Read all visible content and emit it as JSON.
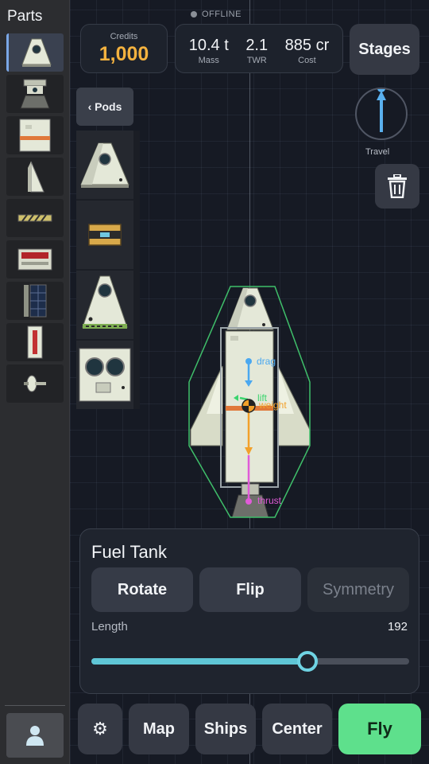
{
  "sidebar": {
    "title": "Parts",
    "parts": [
      {
        "icon": "pod-part-icon",
        "selected": true
      },
      {
        "icon": "engine-part-icon"
      },
      {
        "icon": "fuel-tank-part-icon"
      },
      {
        "icon": "fin-part-icon"
      },
      {
        "icon": "separator-part-icon"
      },
      {
        "icon": "battery-part-icon"
      },
      {
        "icon": "solar-panel-part-icon"
      },
      {
        "icon": "gauge-part-icon"
      },
      {
        "icon": "antenna-part-icon"
      }
    ],
    "profile_icon": "user-icon"
  },
  "status": {
    "offline_text": "OFFLINE"
  },
  "header": {
    "credits_label": "Credits",
    "credits_value": "1,000",
    "mass_value": "10.4 t",
    "mass_label": "Mass",
    "twr_value": "2.1",
    "twr_label": "TWR",
    "cost_value": "885 cr",
    "cost_label": "Cost",
    "stages_label": "Stages"
  },
  "travel": {
    "label": "Travel",
    "icon": "travel-direction-icon"
  },
  "trash": {
    "icon": "trash-icon"
  },
  "category": {
    "tab_label": "‹ Pods",
    "items": [
      {
        "name": "command-pod",
        "icon": "pod-icon"
      },
      {
        "name": "probe-core",
        "icon": "probe-icon"
      },
      {
        "name": "large-pod",
        "icon": "large-pod-icon"
      },
      {
        "name": "cabin",
        "icon": "cabin-icon"
      }
    ]
  },
  "vectors": {
    "drag": "drag",
    "lift": "lift",
    "weight": "weight",
    "thrust": "thrust"
  },
  "colors": {
    "drag": "#4aa8f0",
    "lift": "#3bd46e",
    "weight": "#f2a02a",
    "thrust": "#e05bd8",
    "credits": "#f4b23f",
    "fly": "#5ee08c",
    "slider": "#5fc6d6"
  },
  "selected_part": {
    "title": "Fuel Tank",
    "rotate_label": "Rotate",
    "flip_label": "Flip",
    "symmetry_label": "Symmetry",
    "length_label": "Length",
    "length_value": "192",
    "length_fraction": 0.68
  },
  "bottom": {
    "settings_icon": "gear-icon",
    "map_label": "Map",
    "ships_label": "Ships",
    "center_label": "Center",
    "fly_label": "Fly"
  }
}
